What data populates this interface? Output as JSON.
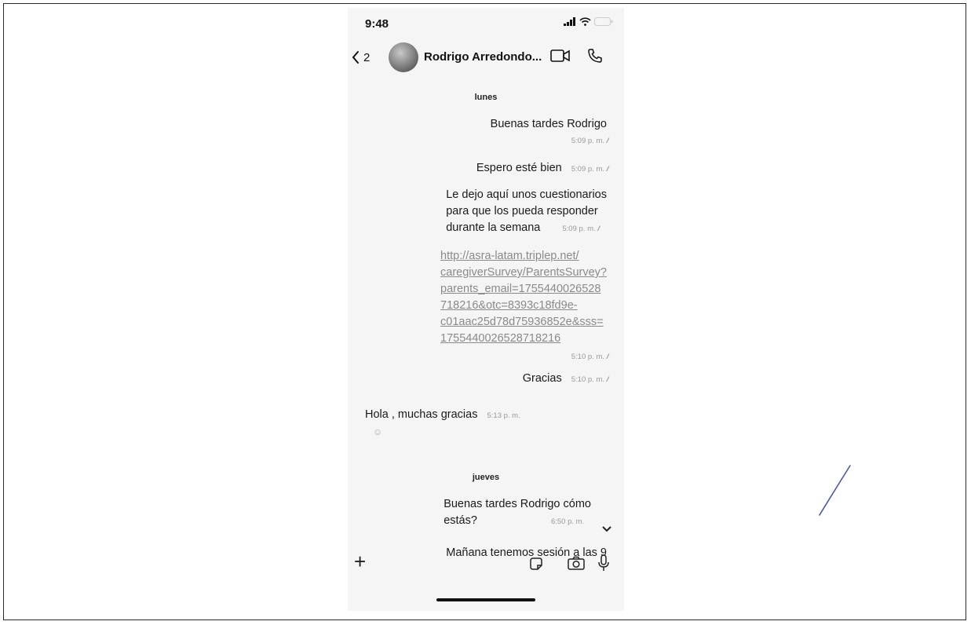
{
  "status_bar": {
    "time": "9:48"
  },
  "header": {
    "back_count": "2",
    "contact_name": "Rodrigo Arredondo..."
  },
  "chat": {
    "days": [
      "lunes",
      "jueves"
    ],
    "messages": [
      {
        "text": "Buenas tardes Rodrigo",
        "time": "5:09 p. m."
      },
      {
        "text": "Espero esté bien",
        "time": "5:09 p. m."
      },
      {
        "lines": [
          "Le dejo aquí unos cuestionarios",
          "para que los pueda responder",
          "durante la semana"
        ],
        "time": "5:09 p. m."
      },
      {
        "link_lines": [
          "http://asra-latam.triplep.net/",
          "caregiverSurvey/ParentsSurvey?",
          "parents_email=1755440026528",
          "718216&otc=8393c18fd9e-",
          "c01aac25d78d75936852e&sss=",
          "1755440026528718216"
        ],
        "time": "5:10 p. m."
      },
      {
        "text": "Gracias",
        "time": "5:10 p. m."
      },
      {
        "text": "Hola , muchas gracias",
        "time": "5:13 p. m.",
        "reaction": "☺"
      },
      {
        "lines": [
          "Buenas tardes Rodrigo cómo",
          "estás?"
        ],
        "time": "6:50 p. m."
      },
      {
        "text": "Mañana tenemos sesión a las 9"
      }
    ]
  },
  "colors": {
    "background": "#f5f5f5",
    "text": "#1a1a1a",
    "meta": "#999999",
    "link": "#8a8a8a"
  },
  "icons": [
    "chevron-left-icon",
    "video-icon",
    "phone-icon",
    "plus-icon",
    "sticker-icon",
    "camera-icon",
    "mic-icon",
    "chevron-down-icon"
  ]
}
